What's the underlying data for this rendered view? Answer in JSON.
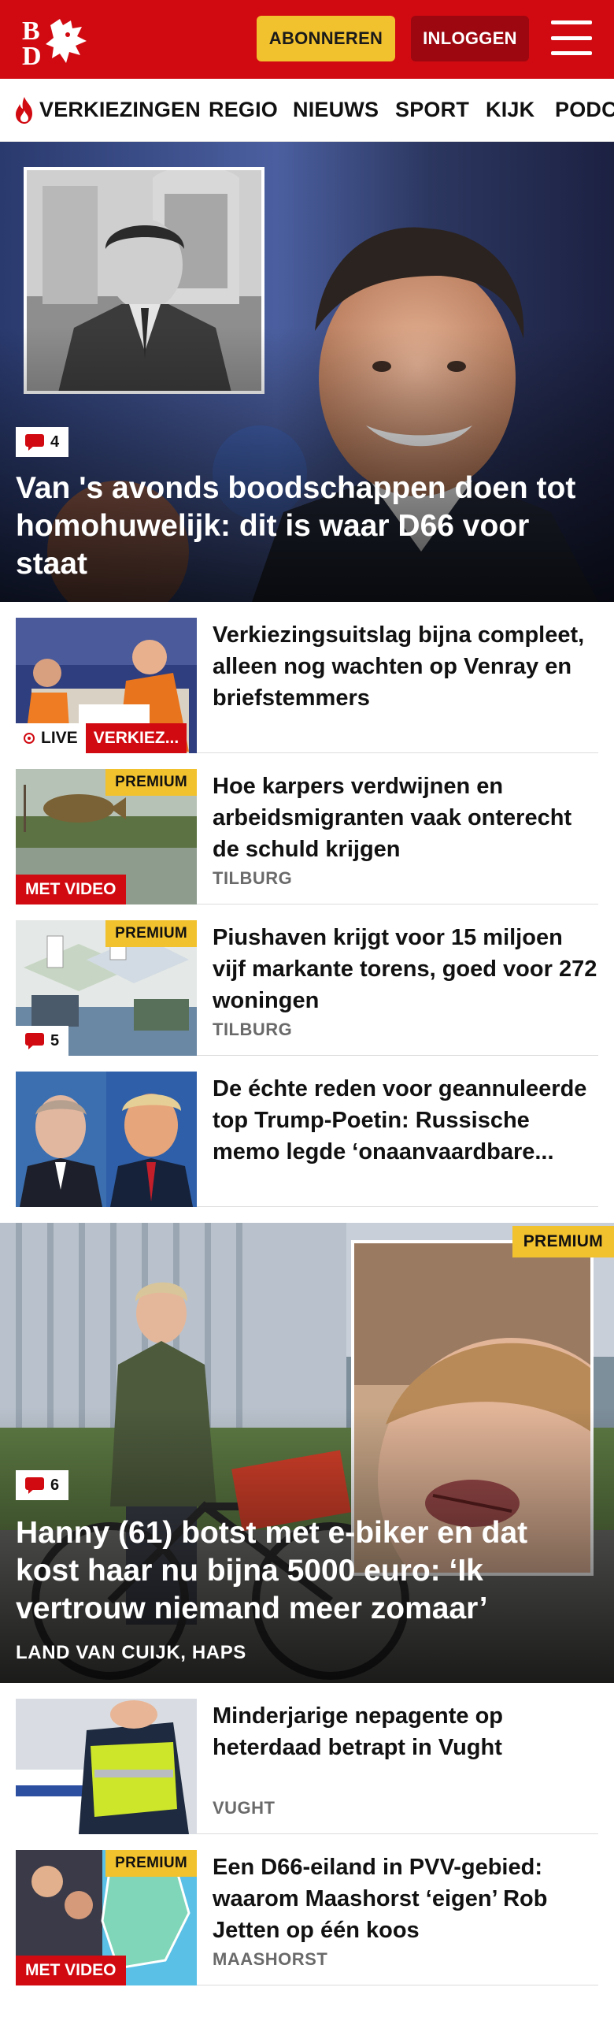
{
  "header": {
    "logo_text": "BD",
    "subscribe_label": "ABONNEREN",
    "login_label": "INLOGGEN",
    "brand_color": "#d10a11",
    "accent_color": "#f2c12e"
  },
  "nav": {
    "items": [
      {
        "label": "VERKIEZINGEN",
        "icon": "flame-icon"
      },
      {
        "label": "REGIO"
      },
      {
        "label": "NIEUWS"
      },
      {
        "label": "SPORT"
      },
      {
        "label": "KIJK"
      },
      {
        "label": "PODC"
      }
    ]
  },
  "hero1": {
    "comments": "4",
    "title": "Van 's avonds boodschappen doen tot homohuwelijk: dit is waar D66 voor staat"
  },
  "articles": [
    {
      "title": "Verkiezingsuitslag bijna compleet, alleen nog wachten op Venray en briefstemmers",
      "live_label": "LIVE",
      "category": "VERKIEZ..."
    },
    {
      "title": "Hoe karpers verdwijnen en arbeidsmigranten vaak onterecht de schuld krijgen",
      "location": "TILBURG",
      "premium": "PREMIUM",
      "video": "MET VIDEO"
    },
    {
      "title": "Piushaven krijgt voor 15 miljoen vijf markante torens, goed voor 272 woningen",
      "location": "TILBURG",
      "premium": "PREMIUM",
      "comments": "5"
    },
    {
      "title": "De échte reden voor geannuleer­de top Trump-Poetin: Russische memo legde ‘onaanvaardbare..."
    }
  ],
  "hero2": {
    "premium": "PREMIUM",
    "comments": "6",
    "title": "Hanny (61) botst met e-biker en dat kost haar nu bijna 5000 euro: ‘Ik vertrouw niemand meer zomaar’",
    "location": "LAND VAN CUIJK, HAPS"
  },
  "articles2": [
    {
      "title": "Minderjarige nepagente op heterdaad betrapt in Vught",
      "location": "VUGHT"
    },
    {
      "title": "Een D66-eiland in PVV-gebied: waarom Maashorst ‘eigen’ Rob Jetten op één koos",
      "location": "MAASHORST",
      "premium": "PREMIUM",
      "video": "MET VIDEO"
    }
  ]
}
